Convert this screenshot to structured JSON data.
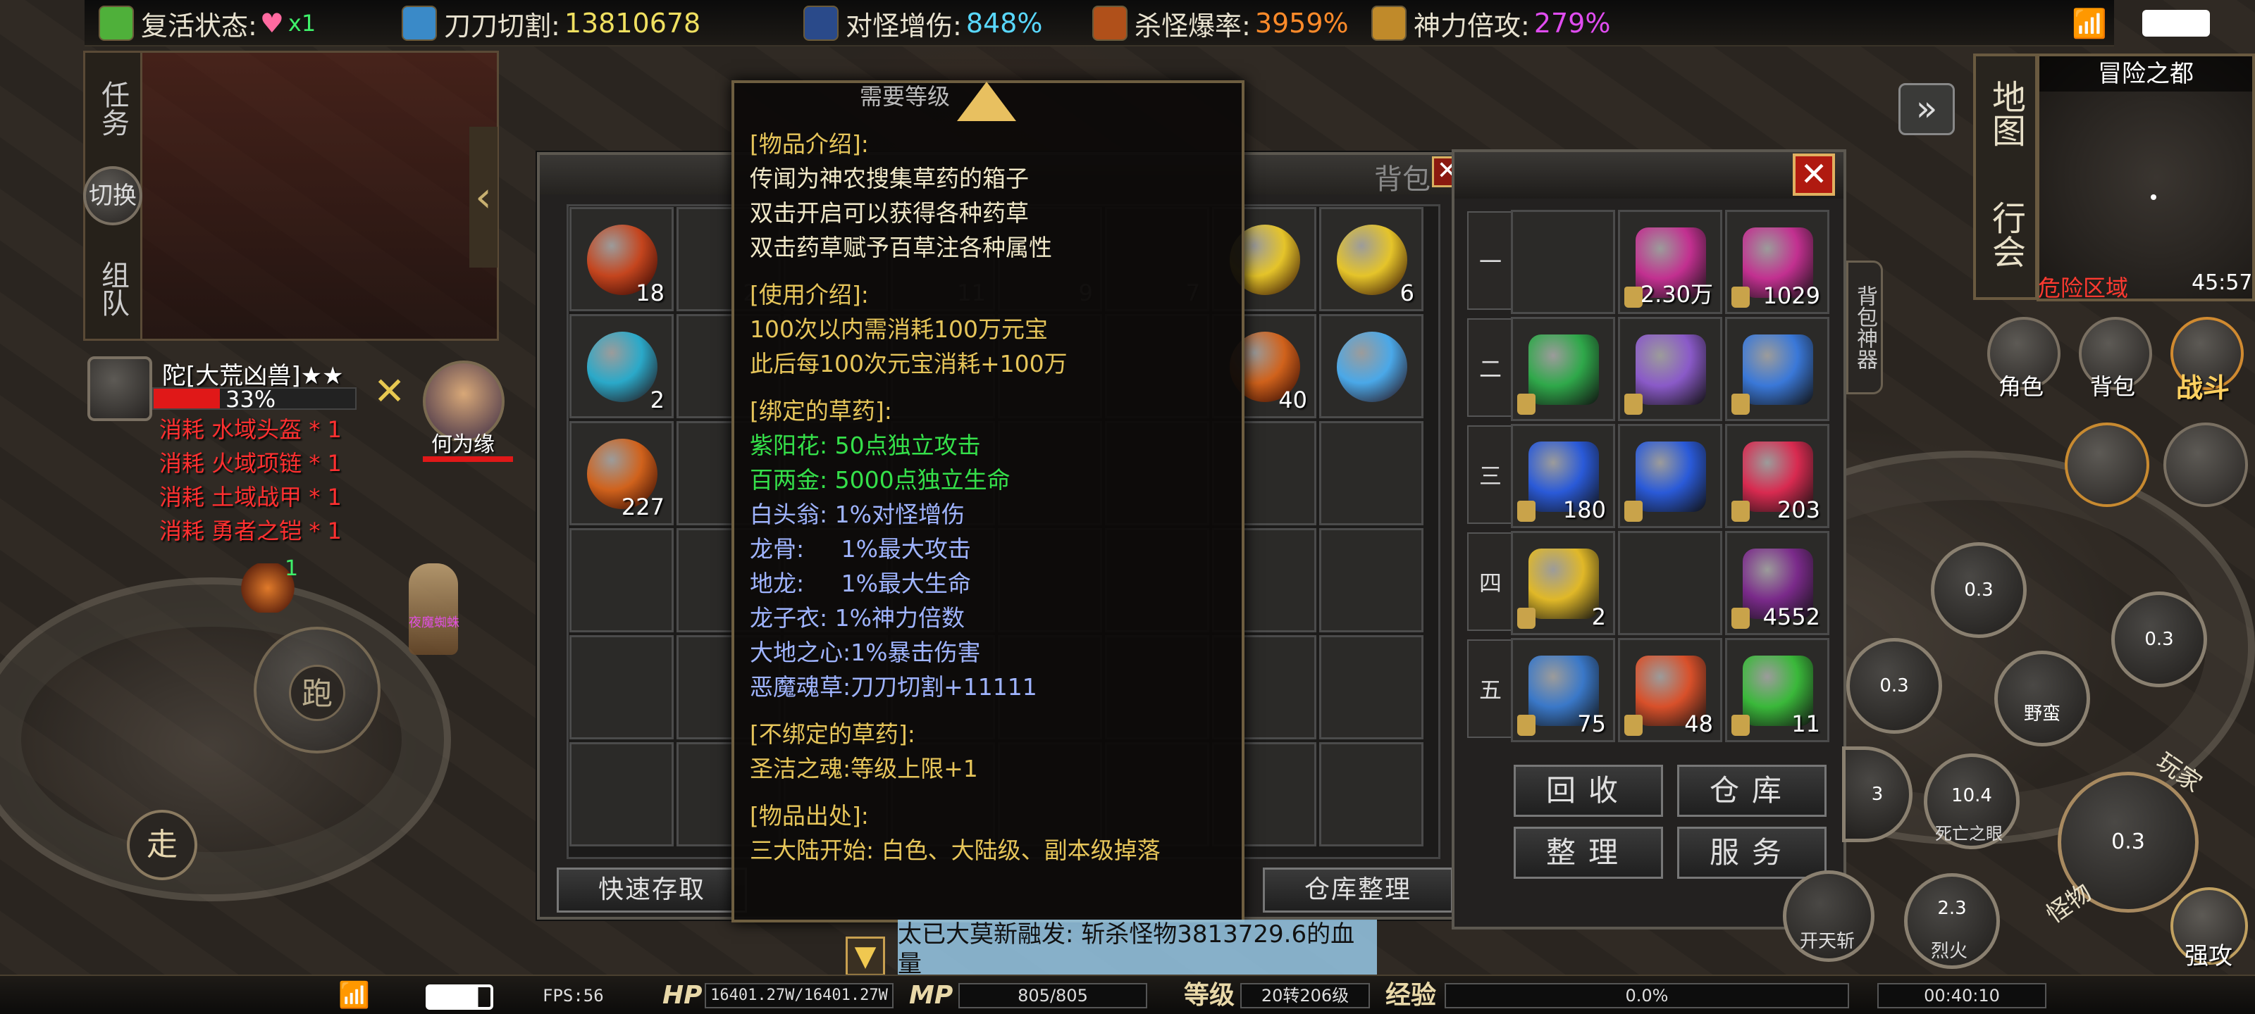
{
  "top_stats": [
    {
      "label": "复活状态:",
      "value": "x1",
      "icon": "heart-icon",
      "value_color": "#3ff06a"
    },
    {
      "label": "刀刀切割:",
      "value": "13810678",
      "icon": "blade-icon",
      "value_color": "#f0e060"
    },
    {
      "label": "对怪增伤:",
      "value": "848%",
      "icon": "demon-icon",
      "value_color": "#59d8ff"
    },
    {
      "label": "杀怪爆率:",
      "value": "3959%",
      "icon": "fire-icon",
      "value_color": "#ff8b2a"
    },
    {
      "label": "神力倍攻:",
      "value": "279%",
      "icon": "power-icon",
      "value_color": "#e04cf0"
    }
  ],
  "left_panel": {
    "tab_task": "任务",
    "tab_switch": "切换",
    "tab_team": "组队"
  },
  "target": {
    "name": "陀[大荒凶兽]★★",
    "hp_percent_text": "33%",
    "hp_fraction": 0.33
  },
  "consume_list": [
    "消耗 水域头盔 * 1",
    "消耗 火域项链 * 1",
    "消耗 土域战甲 * 1",
    "消耗 勇者之铠 * 1"
  ],
  "player": {
    "name": "何为缘"
  },
  "world": {
    "monster_name": "夜魔蜘蛛",
    "pet_level": "1"
  },
  "controls": {
    "run": "跑",
    "walk": "走"
  },
  "warehouse": {
    "title": "背包",
    "quick_store": "快速存取",
    "organize": "仓库整理",
    "items": [
      {
        "count": "18",
        "color": "#c4451e"
      },
      {
        "count": "2",
        "color": "#2aa9c9"
      },
      {
        "count": "227",
        "color": "#d0621c"
      },
      {
        "count": "6",
        "color": "#e5c42a"
      },
      {
        "count": "40",
        "color": "#d0621c"
      },
      {
        "count": "",
        "color": "#e5c42a"
      },
      {
        "count": "",
        "color": "#4aa8e8"
      }
    ],
    "faded_counts": [
      "21",
      "11",
      "9",
      "7"
    ]
  },
  "tooltip": {
    "top_text": "需要等级",
    "sections": [
      {
        "header": "[物品介绍]:",
        "lines": [
          "传闻为神农搜集草药的箱子",
          "双击开启可以获得各种药草",
          "双击药草赋予百草注各种属性"
        ],
        "color": "tip-w"
      },
      {
        "header": "[使用介绍]:",
        "lines": [
          "100次以内需消耗100万元宝",
          "此后每100次元宝消耗+100万"
        ],
        "color": "tip-h"
      },
      {
        "header": "[绑定的草药]:",
        "lines": [
          "紫阳花: 50点独立攻击",
          "百两金: 5000点独立生命"
        ],
        "color": "tip-g"
      },
      {
        "header": "",
        "lines": [
          "白头翁: 1%对怪增伤",
          "龙骨:     1%最大攻击",
          "地龙:     1%最大生命",
          "龙子衣: 1%神力倍数",
          "大地之心:1%暴击伤害",
          "恶魔魂草:刀刀切割+11111"
        ],
        "color": "tip-b"
      },
      {
        "header": "[不绑定的草药]:",
        "lines": [
          "圣洁之魂:等级上限+1"
        ],
        "color": "tip-h"
      },
      {
        "header": "[物品出处]:",
        "lines": [
          "三大陆开始: 白色、大陆级、副本级掉落"
        ],
        "color": "tip-h"
      }
    ]
  },
  "bag": {
    "side_label": "背包神器",
    "tabs": [
      "一",
      "二",
      "三",
      "四",
      "五"
    ],
    "items": [
      {
        "count": "",
        "color": "#333"
      },
      {
        "count": "2.30万",
        "color": "#c23090"
      },
      {
        "count": "1029",
        "color": "#c23090"
      },
      {
        "count": "",
        "color": "#2fa84a"
      },
      {
        "count": "",
        "color": "#8a5ac8"
      },
      {
        "count": "",
        "color": "#3a78d8"
      },
      {
        "count": "180",
        "color": "#2a5ad8"
      },
      {
        "count": "",
        "color": "#2a5ad8"
      },
      {
        "count": "203",
        "color": "#d82a50"
      },
      {
        "count": "2",
        "color": "#e0b828"
      },
      {
        "count": "",
        "color": "#333"
      },
      {
        "count": "4552",
        "color": "#7a2a8a"
      },
      {
        "count": "75",
        "color": "#3a78c8"
      },
      {
        "count": "48",
        "color": "#d8502a"
      },
      {
        "count": "11",
        "color": "#3ab83a"
      }
    ],
    "buttons": [
      "回收",
      "仓库",
      "整理",
      "服务"
    ]
  },
  "minimap": {
    "map_label": "地图",
    "guild_label": "行会",
    "location": "冒险之都",
    "danger": "危险区域",
    "time": "45:57"
  },
  "right_menu": [
    "角色",
    "背包",
    "战斗"
  ],
  "skills": [
    {
      "name": "",
      "cd": "0.3"
    },
    {
      "name": "",
      "cd": "0.3"
    },
    {
      "name": "",
      "cd": "0.3"
    },
    {
      "name": "野蛮",
      "cd": ""
    },
    {
      "name": "死亡之眼",
      "cd": "10.4"
    },
    {
      "name": "烈火",
      "cd": "2.3"
    },
    {
      "name": "开天斩",
      "cd": ""
    },
    {
      "name": "",
      "cd": "0.3"
    },
    {
      "name": "",
      "cd": "3"
    }
  ],
  "side_buttons": [
    "玩家",
    "怪物",
    "强攻"
  ],
  "chat_line": "太已大莫新融发: 斩杀怪物3813729.6的血量",
  "bottom_bar": {
    "fps": "FPS:56",
    "hp_label": "HP",
    "hp": "16401.27W/16401.27W",
    "mp_label": "MP",
    "mp": "805/805",
    "level_label": "等级",
    "level": "20转206级",
    "exp_label": "经验",
    "exp": "0.0%",
    "clock": "00:40:10"
  }
}
